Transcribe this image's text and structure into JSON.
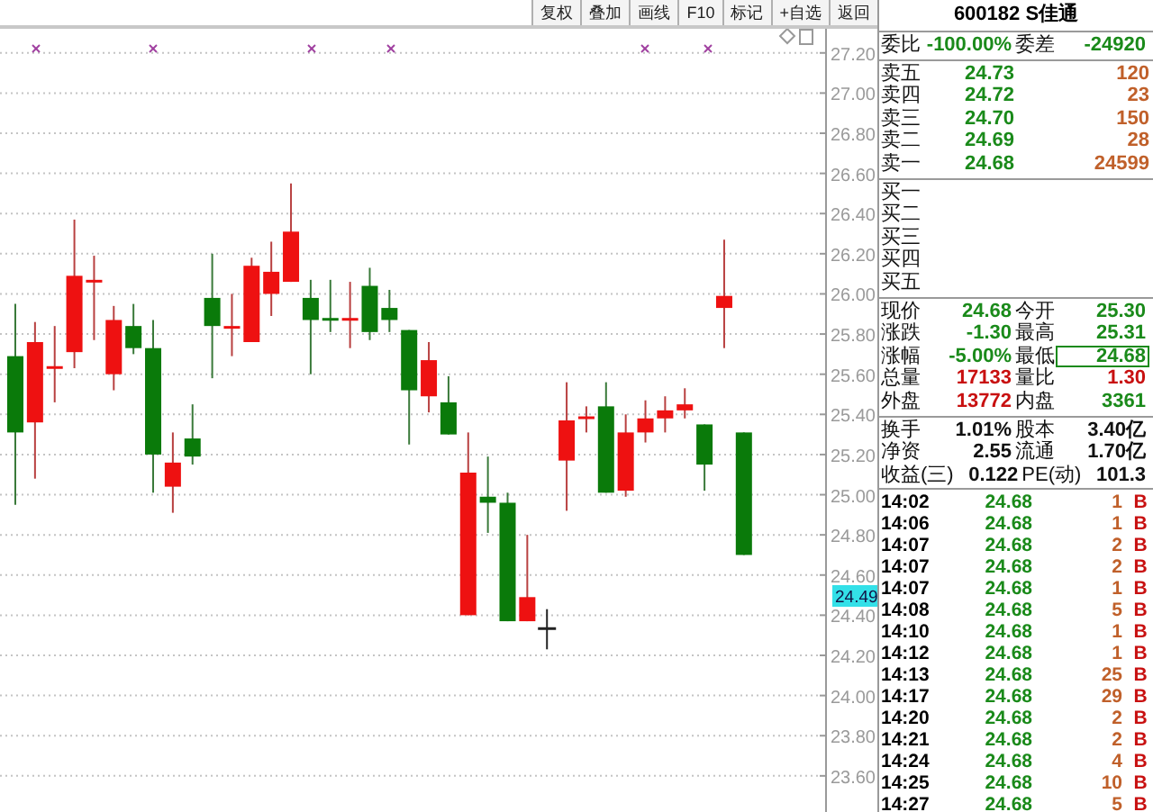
{
  "toolbar": {
    "buttons": [
      "复权",
      "叠加",
      "画线",
      "F10",
      "标记",
      "+自选",
      "返回"
    ]
  },
  "chart": {
    "cursor_price": "24.49",
    "chart_data": {
      "type": "candlestick",
      "grid": true,
      "ohlc": [
        [
          25.69,
          25.95,
          24.95,
          25.31
        ],
        [
          25.36,
          25.86,
          25.08,
          25.76
        ],
        [
          25.63,
          25.84,
          25.46,
          25.64
        ],
        [
          25.71,
          26.37,
          25.63,
          26.09
        ],
        [
          26.06,
          26.19,
          25.77,
          26.07
        ],
        [
          25.6,
          25.94,
          25.52,
          25.87
        ],
        [
          25.84,
          25.95,
          25.7,
          25.73
        ],
        [
          25.73,
          25.87,
          25.01,
          25.2
        ],
        [
          25.04,
          25.31,
          24.91,
          25.16
        ],
        [
          25.28,
          25.45,
          25.15,
          25.19
        ],
        [
          25.98,
          26.2,
          25.58,
          25.84
        ],
        [
          25.83,
          26.0,
          25.69,
          25.84
        ],
        [
          25.76,
          26.18,
          25.76,
          26.14
        ],
        [
          26.0,
          26.26,
          25.89,
          26.11
        ],
        [
          26.06,
          26.55,
          26.06,
          26.31
        ],
        [
          25.98,
          26.07,
          25.6,
          25.87
        ],
        [
          25.88,
          26.07,
          25.81,
          25.87
        ],
        [
          25.87,
          26.06,
          25.73,
          25.88
        ],
        [
          26.04,
          26.13,
          25.77,
          25.81
        ],
        [
          25.93,
          26.02,
          25.81,
          25.87
        ],
        [
          25.82,
          25.82,
          25.25,
          25.52
        ],
        [
          25.49,
          25.76,
          25.41,
          25.67
        ],
        [
          25.46,
          25.59,
          25.3,
          25.3
        ],
        [
          24.4,
          25.31,
          24.4,
          25.11
        ],
        [
          24.99,
          25.19,
          24.81,
          24.96
        ],
        [
          24.96,
          25.01,
          24.37,
          24.37
        ],
        [
          24.37,
          24.8,
          24.37,
          24.49
        ],
        [
          24.34,
          24.43,
          24.23,
          24.34
        ],
        [
          25.17,
          25.56,
          24.92,
          25.37
        ],
        [
          25.38,
          25.44,
          25.31,
          25.39
        ],
        [
          25.44,
          25.56,
          25.01,
          25.01
        ],
        [
          25.02,
          25.4,
          24.99,
          25.31
        ],
        [
          25.31,
          25.47,
          25.26,
          25.38
        ],
        [
          25.38,
          25.49,
          25.31,
          25.42
        ],
        [
          25.42,
          25.53,
          25.38,
          25.45
        ],
        [
          25.35,
          25.35,
          25.02,
          25.15
        ],
        [
          25.93,
          26.27,
          25.73,
          25.99
        ],
        [
          25.31,
          25.31,
          24.7,
          24.7
        ]
      ],
      "ylim": [
        23.42,
        27.32
      ],
      "yticks": [
        {
          "value": 27.2,
          "label": "27.20"
        },
        {
          "value": 27.0,
          "label": "27.00"
        },
        {
          "value": 26.8,
          "label": "26.80"
        },
        {
          "value": 26.6,
          "label": "26.60"
        },
        {
          "value": 26.4,
          "label": "26.40"
        },
        {
          "value": 26.2,
          "label": "26.20"
        },
        {
          "value": 26.0,
          "label": "26.00"
        },
        {
          "value": 25.8,
          "label": "25.80"
        },
        {
          "value": 25.6,
          "label": "25.60"
        },
        {
          "value": 25.4,
          "label": "25.40"
        },
        {
          "value": 25.2,
          "label": "25.20"
        },
        {
          "value": 25.0,
          "label": "25.00"
        },
        {
          "value": 24.8,
          "label": "24.80"
        },
        {
          "value": 24.6,
          "label": "24.60"
        },
        {
          "value": 24.4,
          "label": "24.40"
        },
        {
          "value": 24.2,
          "label": "24.20"
        },
        {
          "value": 24.0,
          "label": "24.00"
        },
        {
          "value": 23.8,
          "label": "23.80"
        },
        {
          "value": 23.6,
          "label": "23.60"
        }
      ]
    }
  },
  "quote": {
    "title": "600182 S佳通",
    "order_ratio": {
      "cells": [
        {
          "label": "委比",
          "value": "-100.00%",
          "color": "#1a8a1a"
        },
        {
          "label": "委差",
          "value": "-24920",
          "color": "#1a8a1a"
        }
      ]
    },
    "asks": [
      {
        "label": "卖五",
        "price": "24.73",
        "volume": "120"
      },
      {
        "label": "卖四",
        "price": "24.72",
        "volume": "23"
      },
      {
        "label": "卖三",
        "price": "24.70",
        "volume": "150"
      },
      {
        "label": "卖二",
        "price": "24.69",
        "volume": "28"
      },
      {
        "label": "卖一",
        "price": "24.68",
        "volume": "24599"
      }
    ],
    "bids": [
      {
        "label": "买一"
      },
      {
        "label": "买二"
      },
      {
        "label": "买三"
      },
      {
        "label": "买四"
      },
      {
        "label": "买五"
      }
    ],
    "stats": [
      {
        "cells": [
          {
            "label": "现价",
            "value": "24.68",
            "color": "#1a8a1a",
            "boxed": false
          },
          {
            "label": "今开",
            "value": "25.30",
            "color": "#1a8a1a",
            "boxed": false
          }
        ]
      },
      {
        "cells": [
          {
            "label": "涨跌",
            "value": "-1.30",
            "color": "#1a8a1a",
            "boxed": false
          },
          {
            "label": "最高",
            "value": "25.31",
            "color": "#1a8a1a",
            "boxed": false
          }
        ]
      },
      {
        "cells": [
          {
            "label": "涨幅",
            "value": "-5.00%",
            "color": "#1a8a1a",
            "boxed": false
          },
          {
            "label": "最低",
            "value": "24.68",
            "color": "#1a8a1a",
            "boxed": true
          }
        ]
      },
      {
        "cells": [
          {
            "label": "总量",
            "value": "17133",
            "color": "#c81010",
            "boxed": false
          },
          {
            "label": "量比",
            "value": "1.30",
            "color": "#c81010",
            "boxed": false
          }
        ]
      },
      {
        "cells": [
          {
            "label": "外盘",
            "value": "13772",
            "color": "#c81010",
            "boxed": false
          },
          {
            "label": "内盘",
            "value": "3361",
            "color": "#1a8a1a",
            "boxed": false
          }
        ]
      }
    ],
    "fundamentals": [
      {
        "cells": [
          {
            "label": "换手",
            "value": "1.01%"
          },
          {
            "label": "股本",
            "value": "3.40亿"
          }
        ]
      },
      {
        "cells": [
          {
            "label": "净资",
            "value": "2.55"
          },
          {
            "label": "流通",
            "value": "1.70亿"
          }
        ]
      },
      {
        "cells": [
          {
            "label": "收益(三)",
            "value": "0.122"
          },
          {
            "label": "PE(动)",
            "value": "101.3"
          }
        ]
      }
    ],
    "trades": [
      {
        "time": "14:02",
        "price": "24.68",
        "volume": "1",
        "side": "B"
      },
      {
        "time": "14:06",
        "price": "24.68",
        "volume": "1",
        "side": "B"
      },
      {
        "time": "14:07",
        "price": "24.68",
        "volume": "2",
        "side": "B"
      },
      {
        "time": "14:07",
        "price": "24.68",
        "volume": "2",
        "side": "B"
      },
      {
        "time": "14:07",
        "price": "24.68",
        "volume": "1",
        "side": "B"
      },
      {
        "time": "14:08",
        "price": "24.68",
        "volume": "5",
        "side": "B"
      },
      {
        "time": "14:10",
        "price": "24.68",
        "volume": "1",
        "side": "B"
      },
      {
        "time": "14:12",
        "price": "24.68",
        "volume": "1",
        "side": "B"
      },
      {
        "time": "14:13",
        "price": "24.68",
        "volume": "25",
        "side": "B"
      },
      {
        "time": "14:17",
        "price": "24.68",
        "volume": "29",
        "side": "B"
      },
      {
        "time": "14:20",
        "price": "24.68",
        "volume": "2",
        "side": "B"
      },
      {
        "time": "14:21",
        "price": "24.68",
        "volume": "2",
        "side": "B"
      },
      {
        "time": "14:24",
        "price": "24.68",
        "volume": "4",
        "side": "B"
      },
      {
        "time": "14:25",
        "price": "24.68",
        "volume": "10",
        "side": "B"
      },
      {
        "time": "14:27",
        "price": "24.68",
        "volume": "5",
        "side": "B"
      }
    ]
  }
}
